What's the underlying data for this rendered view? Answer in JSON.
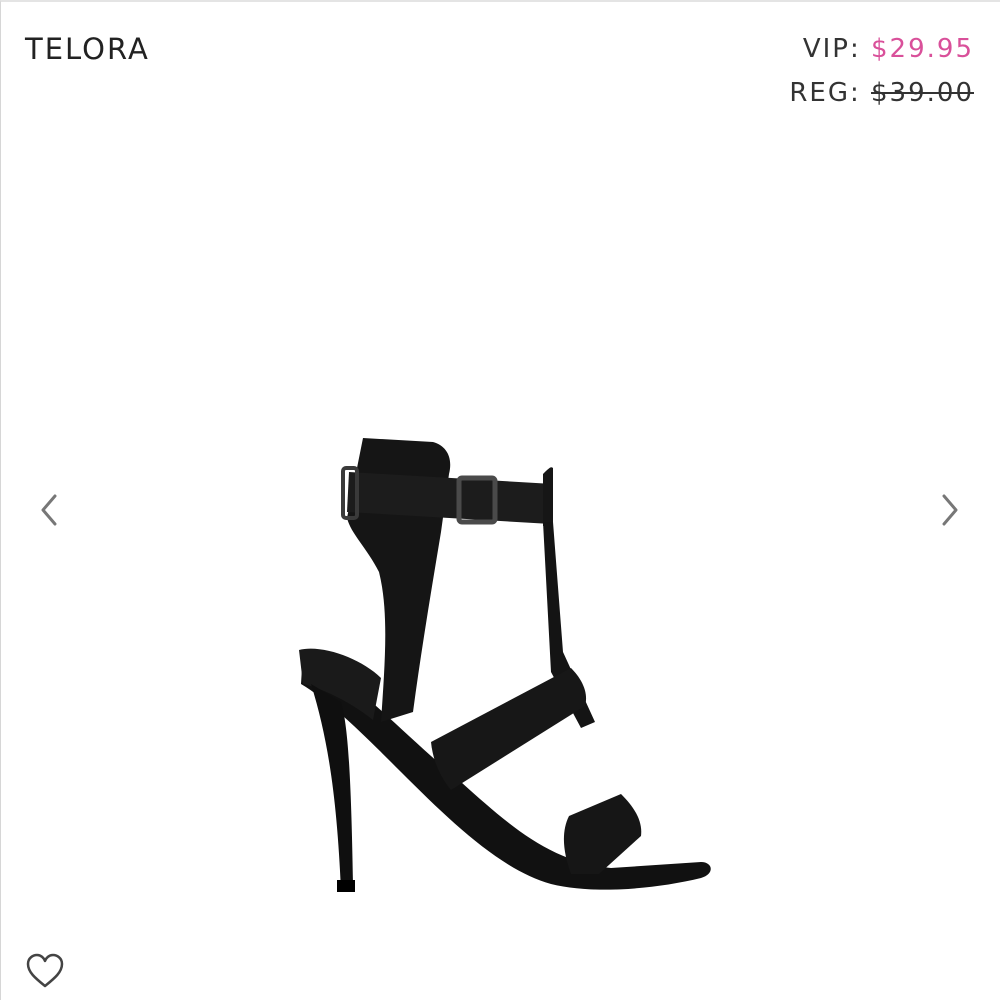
{
  "product": {
    "name": "TELORA"
  },
  "pricing": {
    "vip_label": "VIP:",
    "vip_price": "$29.95",
    "reg_label": "REG:",
    "reg_price": "$39.00",
    "vip_color": "#d9509a"
  },
  "gallery": {
    "prev_icon": "chevron-left-icon",
    "next_icon": "chevron-right-icon",
    "image_subject": "black strappy high-heel sandal"
  },
  "actions": {
    "favorite_icon": "heart-outline-icon"
  }
}
